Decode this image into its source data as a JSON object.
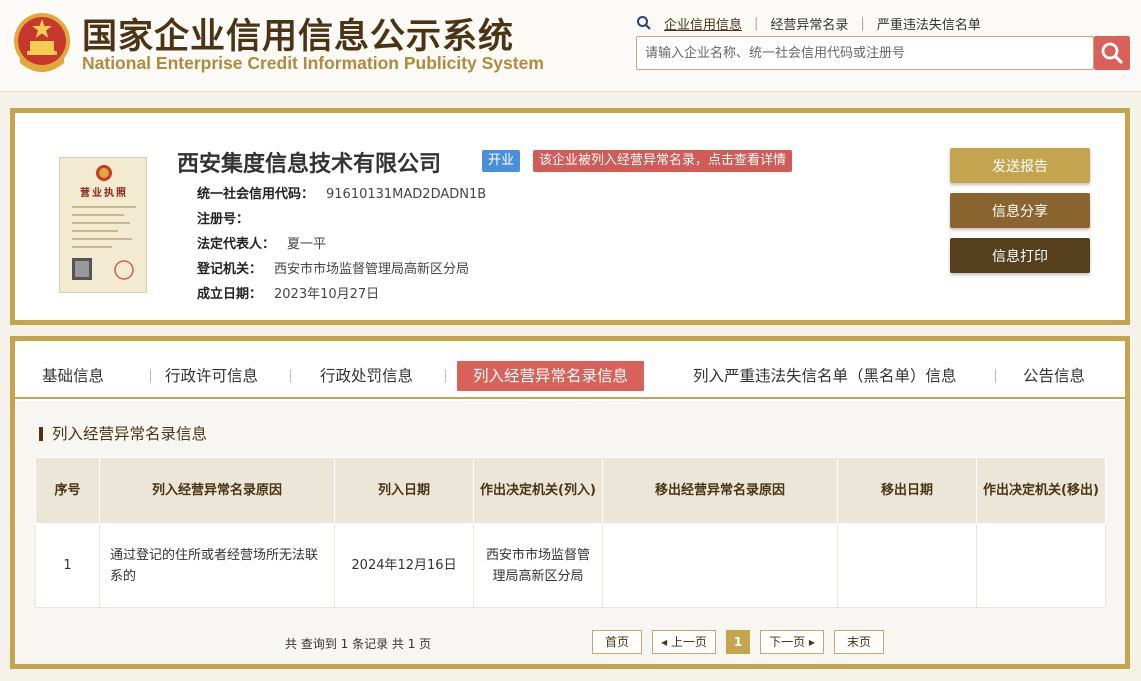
{
  "header": {
    "title_cn": "国家企业信用信息公示系统",
    "title_en": "National Enterprise Credit Information Publicity System",
    "links": [
      "企业信用信息",
      "经营异常名录",
      "严重违法失信名单"
    ],
    "search_placeholder": "请输入企业名称、统一社会信用代码或注册号"
  },
  "company": {
    "name": "西安集度信息技术有限公司",
    "status_badge": "开业",
    "warning_badge": "该企业被列入经营异常名录，点击查看详情",
    "fields": [
      {
        "label": "统一社会信用代码：",
        "value": "91610131MAD2DADN1B"
      },
      {
        "label": "注册号：",
        "value": ""
      },
      {
        "label": "法定代表人：",
        "value": "夏一平"
      },
      {
        "label": "登记机关：",
        "value": "西安市市场监督管理局高新区分局"
      },
      {
        "label": "成立日期：",
        "value": "2023年10月27日"
      }
    ],
    "license_title": "营业执照",
    "actions": [
      "发送报告",
      "信息分享",
      "信息打印"
    ]
  },
  "tabs": [
    "基础信息",
    "行政许可信息",
    "行政处罚信息",
    "列入经营异常名录信息",
    "列入严重违法失信名单（黑名单）信息",
    "公告信息"
  ],
  "section": {
    "title": "列入经营异常名录信息",
    "columns": [
      "序号",
      "列入经营异常名录原因",
      "列入日期",
      "作出决定机关(列入)",
      "移出经营异常名录原因",
      "移出日期",
      "作出决定机关(移出)"
    ],
    "rows": [
      [
        "1",
        "通过登记的住所或者经营场所无法联系的",
        "2024年12月16日",
        "西安市市场监督管理局高新区分局",
        "",
        "",
        ""
      ]
    ]
  },
  "pager": {
    "info": "共 查询到 1 条记录 共 1 页",
    "first": "首页",
    "prev": "◂ 上一页",
    "current": "1",
    "next": "下一页 ▸",
    "last": "末页"
  },
  "colors": {
    "brown": "#4a3414",
    "gold": "#c4a44f",
    "red": "#d8615a",
    "blue": "#4b8fd9"
  }
}
